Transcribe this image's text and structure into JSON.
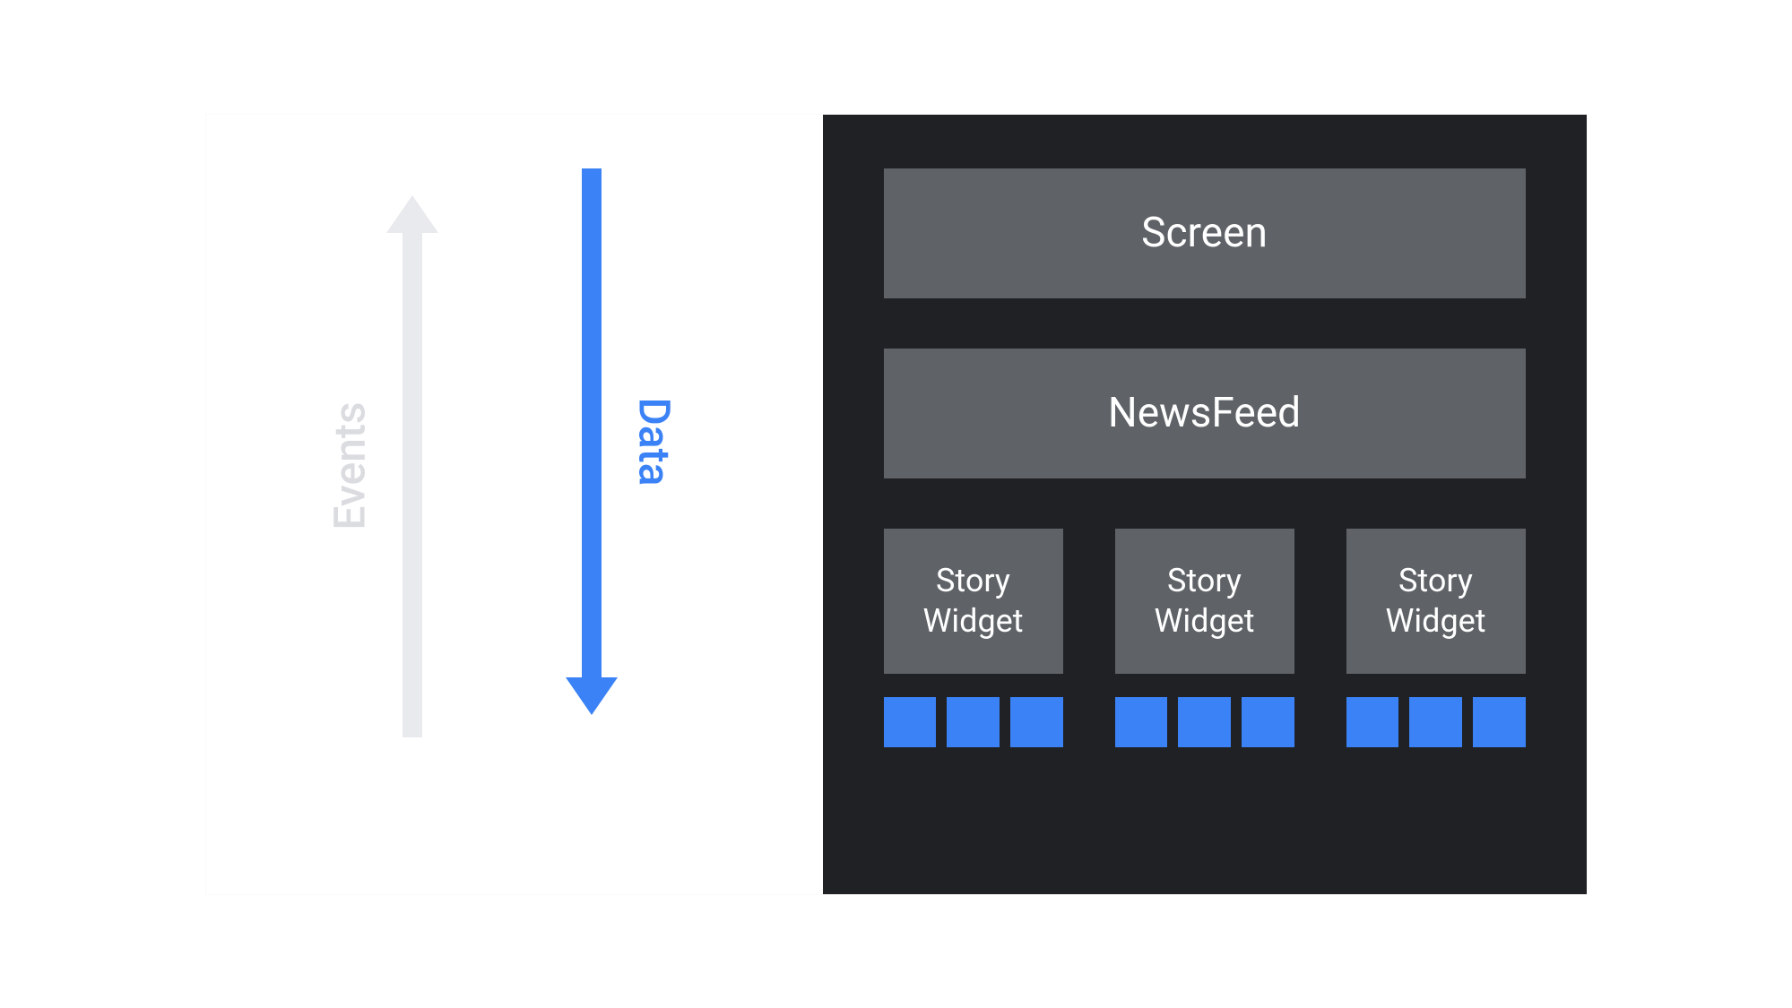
{
  "arrows": {
    "events": {
      "label": "Events",
      "direction": "up",
      "color": "#e8eaed"
    },
    "data": {
      "label": "Data",
      "direction": "down",
      "color": "#3b82f6"
    }
  },
  "hierarchy": {
    "screen": {
      "label": "Screen"
    },
    "newsfeed": {
      "label": "NewsFeed"
    },
    "storyWidgets": [
      {
        "label": "Story Widget",
        "chips": 3
      },
      {
        "label": "Story Widget",
        "chips": 3
      },
      {
        "label": "Story Widget",
        "chips": 3
      }
    ]
  },
  "colors": {
    "accent": "#3b82f6",
    "muted": "#e8eaed",
    "darkBg": "#202124",
    "boxBg": "#5f6368"
  }
}
